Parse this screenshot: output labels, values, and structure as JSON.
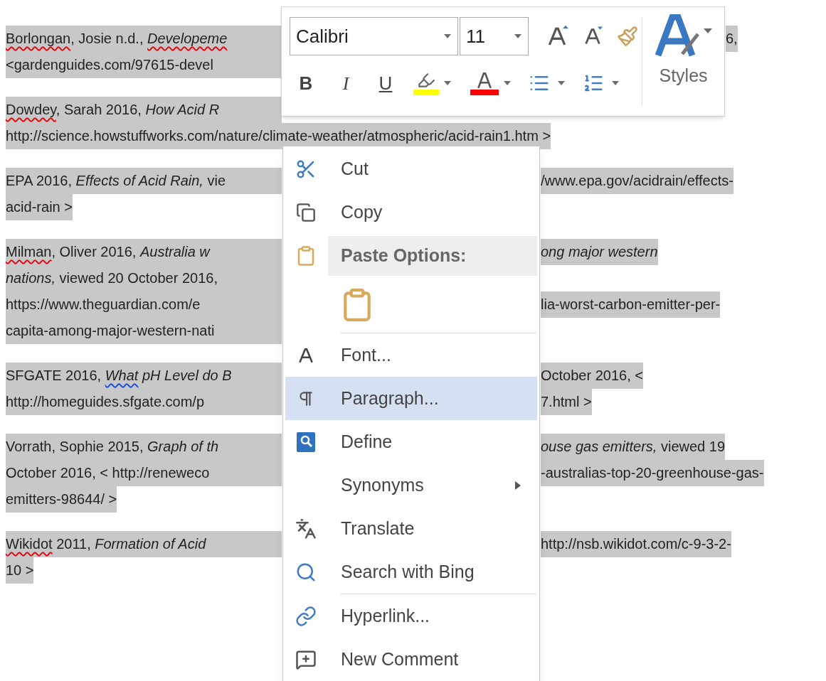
{
  "document": {
    "paragraphs": [
      {
        "lines": [
          {
            "kind": "covered",
            "left": [
              {
                "text": "Borlongan",
                "kind": "misspelled"
              },
              {
                "text": ", Josie n.d., ",
                "kind": "plain"
              },
              {
                "text": "Developeme",
                "kind": "misspelled-italic"
              }
            ],
            "right": [
              {
                "text": "6,",
                "kind": "plain"
              }
            ]
          },
          {
            "kind": "covered",
            "left": [
              {
                "text": "<gardenguides.com/97615-devel",
                "kind": "plain"
              }
            ]
          }
        ]
      },
      {
        "lines": [
          {
            "kind": "covered",
            "left": [
              {
                "text": "Dowdey",
                "kind": "misspelled"
              },
              {
                "text": ", Sarah 2016, ",
                "kind": "plain"
              },
              {
                "text": "How Acid R",
                "kind": "italic"
              }
            ]
          },
          {
            "kind": "open",
            "left": [
              {
                "text": "http://science.howstuffworks.com/nature/climate-weather/atmospheric/acid-rain1.htm >",
                "kind": "plain"
              }
            ]
          }
        ]
      },
      {
        "lines": [
          {
            "kind": "covered",
            "left": [
              {
                "text": "EPA 2016, ",
                "kind": "plain"
              },
              {
                "text": "Effects of Acid Rain,",
                "kind": "italic"
              },
              {
                "text": " vie",
                "kind": "plain"
              }
            ],
            "right": [
              {
                "text": "/www.epa.gov/acidrain/effects-",
                "kind": "plain"
              }
            ]
          },
          {
            "kind": "open",
            "left": [
              {
                "text": "acid-rain >",
                "kind": "plain"
              }
            ]
          }
        ]
      },
      {
        "lines": [
          {
            "kind": "covered",
            "left": [
              {
                "text": "Milman",
                "kind": "misspelled"
              },
              {
                "text": ", Oliver 2016, ",
                "kind": "plain"
              },
              {
                "text": "Australia w",
                "kind": "italic"
              }
            ],
            "right": [
              {
                "text": "ong major western",
                "kind": "italic"
              }
            ]
          },
          {
            "kind": "covered",
            "left": [
              {
                "text": "nations,",
                "kind": "italic"
              },
              {
                "text": " viewed 20 October 2016,",
                "kind": "plain"
              }
            ]
          },
          {
            "kind": "covered",
            "left": [
              {
                "text": "https://www.theguardian.com/e",
                "kind": "plain"
              }
            ],
            "right": [
              {
                "text": "lia-worst-carbon-emitter-per-",
                "kind": "plain"
              }
            ]
          },
          {
            "kind": "covered",
            "left": [
              {
                "text": "capita-among-major-western-nati",
                "kind": "plain"
              }
            ]
          }
        ]
      },
      {
        "lines": [
          {
            "kind": "covered",
            "left": [
              {
                "text": "SFGATE 2016, ",
                "kind": "plain"
              },
              {
                "text": "What",
                "kind": "grammar-italic"
              },
              {
                "text": " pH Level do B",
                "kind": "italic"
              }
            ],
            "right": [
              {
                "text": "October 2016, <",
                "kind": "plain"
              }
            ]
          },
          {
            "kind": "covered",
            "left": [
              {
                "text": "http://homeguides.sfgate.com/p",
                "kind": "plain"
              }
            ],
            "right": [
              {
                "text": "7.html >",
                "kind": "plain"
              }
            ]
          }
        ]
      },
      {
        "lines": [
          {
            "kind": "covered",
            "left": [
              {
                "text": "Vorrath, Sophie 2015, ",
                "kind": "plain"
              },
              {
                "text": "Graph of th",
                "kind": "italic"
              }
            ],
            "right": [
              {
                "text": "ouse gas emitters,",
                "kind": "italic"
              },
              {
                "text": " viewed 19",
                "kind": "plain"
              }
            ]
          },
          {
            "kind": "covered",
            "left": [
              {
                "text": "October 2016, < http://reneweco",
                "kind": "plain"
              }
            ],
            "right": [
              {
                "text": "-australias-top-20-greenhouse-gas-",
                "kind": "plain"
              }
            ]
          },
          {
            "kind": "open",
            "left": [
              {
                "text": "emitters-98644/ >",
                "kind": "plain"
              }
            ]
          }
        ]
      },
      {
        "lines": [
          {
            "kind": "covered",
            "left": [
              {
                "text": "Wikidot",
                "kind": "misspelled"
              },
              {
                "text": " 2011, ",
                "kind": "plain"
              },
              {
                "text": "Formation of Acid ",
                "kind": "italic"
              }
            ],
            "right": [
              {
                "text": "http://nsb.wikidot.com/c-9-3-2-",
                "kind": "plain"
              }
            ]
          },
          {
            "kind": "open",
            "left": [
              {
                "text": "10 >",
                "kind": "plain"
              }
            ]
          }
        ]
      }
    ]
  },
  "mini_toolbar": {
    "font": "Calibri",
    "size": "11",
    "format_buttons": [
      {
        "label": "B"
      },
      {
        "label": "I"
      },
      {
        "label": "U"
      }
    ],
    "styles_label": "Styles"
  },
  "context_menu": {
    "items": [
      {
        "kind": "item",
        "label": "Cut",
        "selected": false,
        "submenu": false
      },
      {
        "kind": "item",
        "label": "Copy",
        "selected": false,
        "submenu": false
      },
      {
        "kind": "header",
        "label": "Paste Options:"
      },
      {
        "kind": "paste-option"
      },
      {
        "kind": "separator"
      },
      {
        "kind": "item",
        "label": "Font...",
        "selected": false,
        "submenu": false
      },
      {
        "kind": "item",
        "label": "Paragraph...",
        "selected": true,
        "submenu": false
      },
      {
        "kind": "item",
        "label": "Define",
        "selected": false,
        "submenu": false
      },
      {
        "kind": "item",
        "label": "Synonyms",
        "selected": false,
        "submenu": true
      },
      {
        "kind": "item",
        "label": "Translate",
        "selected": false,
        "submenu": false
      },
      {
        "kind": "item",
        "label": "Search with Bing",
        "selected": false,
        "submenu": false
      },
      {
        "kind": "separator"
      },
      {
        "kind": "item",
        "label": "Hyperlink...",
        "selected": false,
        "submenu": false
      },
      {
        "kind": "item",
        "label": "New Comment",
        "selected": false,
        "submenu": false
      }
    ]
  }
}
